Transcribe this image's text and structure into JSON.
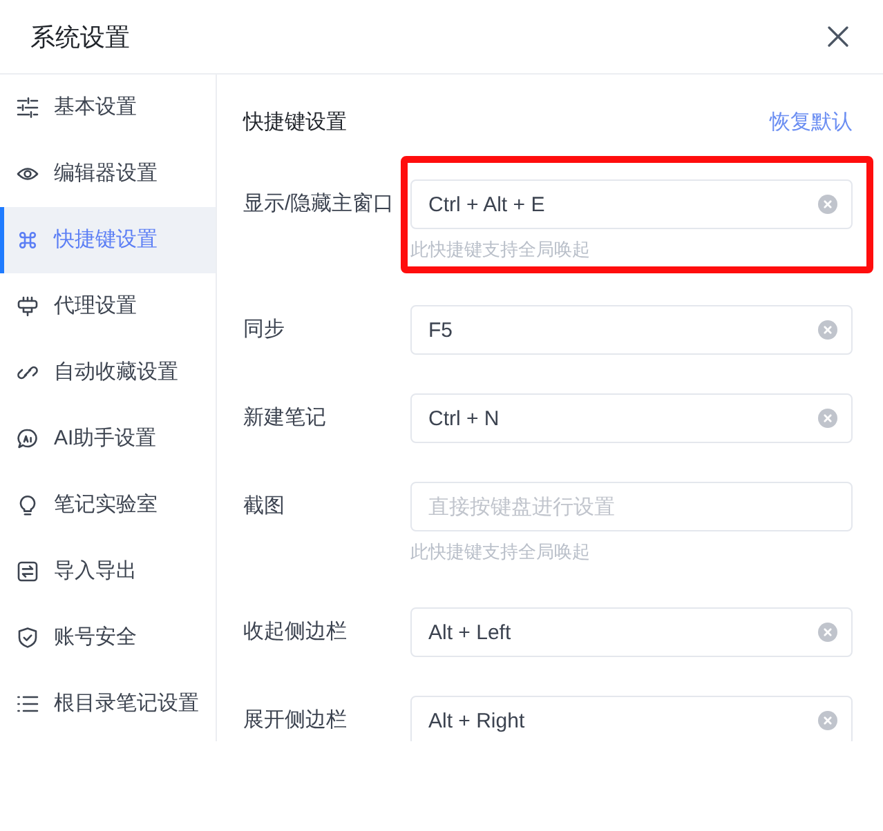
{
  "window": {
    "title": "系统设置"
  },
  "sidebar": {
    "items": [
      {
        "label": "基本设置",
        "selected": false
      },
      {
        "label": "编辑器设置",
        "selected": false
      },
      {
        "label": "快捷键设置",
        "selected": true
      },
      {
        "label": "代理设置",
        "selected": false
      },
      {
        "label": "自动收藏设置",
        "selected": false
      },
      {
        "label": "AI助手设置",
        "selected": false
      },
      {
        "label": "笔记实验室",
        "selected": false
      },
      {
        "label": "导入导出",
        "selected": false
      },
      {
        "label": "账号安全",
        "selected": false
      },
      {
        "label": "根目录笔记设置",
        "selected": false
      }
    ]
  },
  "content": {
    "title": "快捷键设置",
    "reset_link": "恢复默认",
    "shortcuts": [
      {
        "label": "显示/隐藏主窗口",
        "value": "Ctrl + Alt + E",
        "hint": "此快捷键支持全局唤起",
        "highlighted": true
      },
      {
        "label": "同步",
        "value": "F5",
        "highlighted": false
      },
      {
        "label": "新建笔记",
        "value": "Ctrl + N",
        "highlighted": false
      },
      {
        "label": "截图",
        "placeholder": "直接按键盘进行设置",
        "hint": "此快捷键支持全局唤起",
        "highlighted": false
      },
      {
        "label": "收起侧边栏",
        "value": "Alt + Left",
        "highlighted": false
      },
      {
        "label": "展开侧边栏",
        "value": "Alt + Right",
        "highlighted": false
      }
    ]
  }
}
